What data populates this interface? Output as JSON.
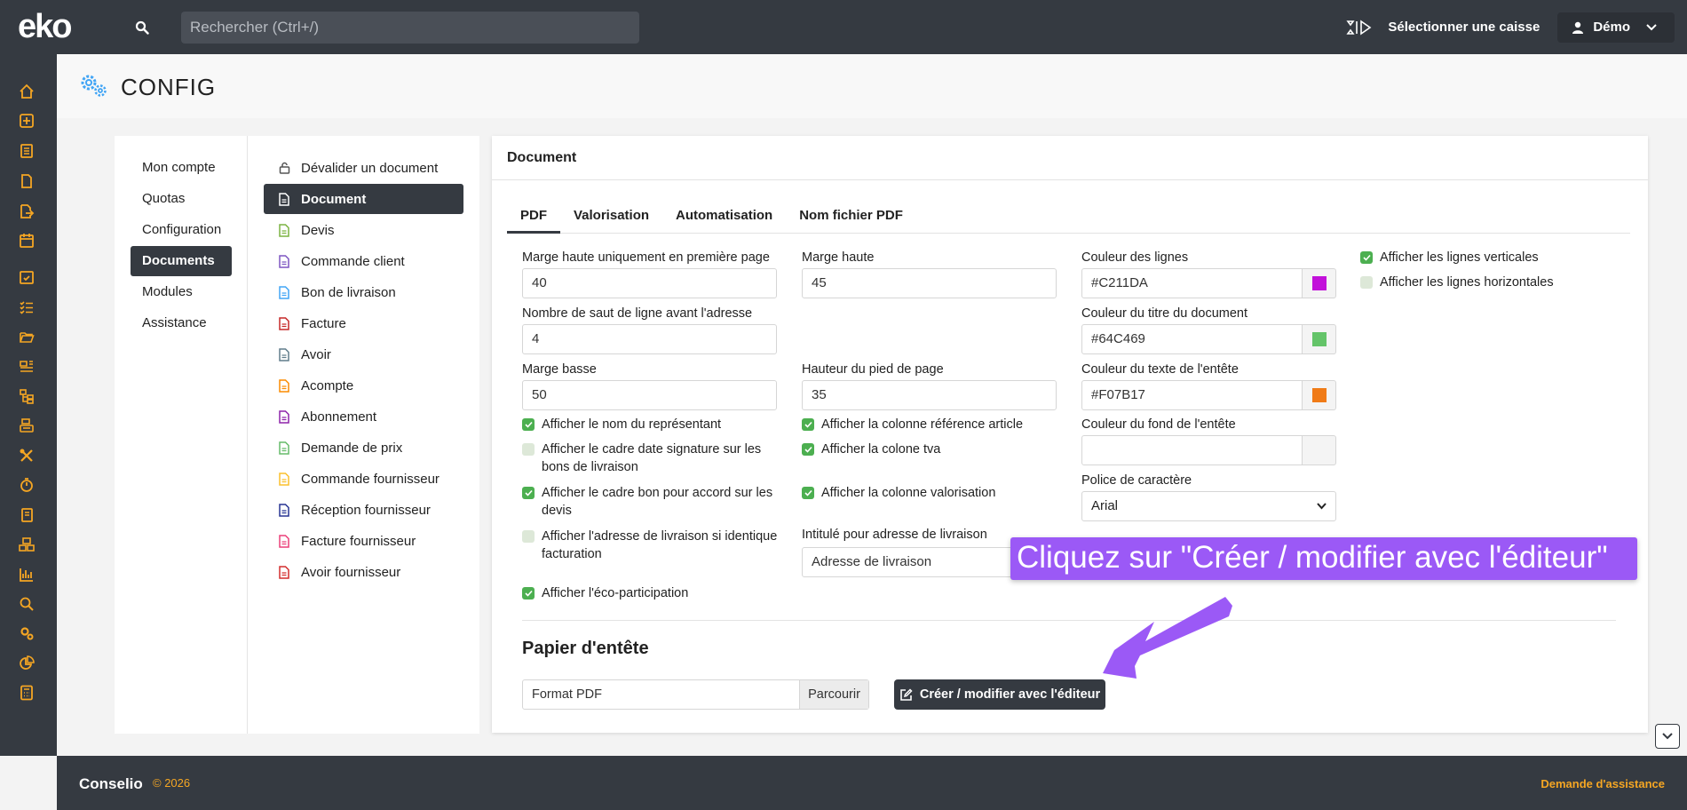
{
  "app": {
    "logo_text": "eko"
  },
  "topbar": {
    "search_placeholder": "Rechercher (Ctrl+/)",
    "caisse_label": "Sélectionner une caisse",
    "user_name": "Démo"
  },
  "page": {
    "title": "CONFIG"
  },
  "menu_main": [
    {
      "label": "Mon compte"
    },
    {
      "label": "Quotas"
    },
    {
      "label": "Configuration"
    },
    {
      "label": "Documents",
      "active": true
    },
    {
      "label": "Modules"
    },
    {
      "label": "Assistance"
    }
  ],
  "menu_docs": [
    {
      "label": "Dévalider un document",
      "color": "#555555"
    },
    {
      "label": "Document",
      "color": "#ffffff",
      "active": true
    },
    {
      "label": "Devis",
      "color": "#7cb342"
    },
    {
      "label": "Commande client",
      "color": "#7e57c2"
    },
    {
      "label": "Bon de livraison",
      "color": "#42a5f5"
    },
    {
      "label": "Facture",
      "color": "#c62828"
    },
    {
      "label": "Avoir",
      "color": "#607d8b"
    },
    {
      "label": "Acompte",
      "color": "#fb8c00"
    },
    {
      "label": "Abonnement",
      "color": "#8e24aa"
    },
    {
      "label": "Demande de prix",
      "color": "#66bb6a"
    },
    {
      "label": "Commande fournisseur",
      "color": "#fbc02d"
    },
    {
      "label": "Réception fournisseur",
      "color": "#283593"
    },
    {
      "label": "Facture fournisseur",
      "color": "#ec407a"
    },
    {
      "label": "Avoir fournisseur",
      "color": "#d32f2f"
    }
  ],
  "card": {
    "title": "Document",
    "tabs": [
      "PDF",
      "Valorisation",
      "Automatisation",
      "Nom fichier PDF"
    ],
    "fields": {
      "marge_haute_premiere": {
        "label": "Marge haute uniquement en première page",
        "value": "40"
      },
      "marge_haute": {
        "label": "Marge haute",
        "value": "45"
      },
      "saut_ligne": {
        "label": "Nombre de saut de ligne avant l'adresse",
        "value": "4"
      },
      "marge_basse": {
        "label": "Marge basse",
        "value": "50"
      },
      "hauteur_pied": {
        "label": "Hauteur du pied de page",
        "value": "35"
      },
      "couleur_lignes": {
        "label": "Couleur des lignes",
        "value": "#C211DA",
        "swatch": "#C211DA"
      },
      "couleur_titre": {
        "label": "Couleur du titre du document",
        "value": "#64C469",
        "swatch": "#64C469"
      },
      "couleur_texte_entete": {
        "label": "Couleur du texte de l'entête",
        "value": "#F07B17",
        "swatch": "#F07B17"
      },
      "couleur_fond_entete": {
        "label": "Couleur du fond de l'entête",
        "value": ""
      },
      "police": {
        "label": "Police de caractère",
        "value": "Arial"
      },
      "intitule_adresse": {
        "label": "Intitulé pour adresse de livraison",
        "value": "Adresse de livraison"
      }
    },
    "checkboxes": {
      "nom_representant": {
        "label": "Afficher le nom du représentant",
        "checked": true
      },
      "cadre_date_signature": {
        "label": "Afficher le cadre date signature sur les bons de livraison",
        "checked": false
      },
      "cadre_bon_accord": {
        "label": "Afficher le cadre bon pour accord sur les devis",
        "checked": true
      },
      "adresse_livraison_identique": {
        "label": "Afficher l'adresse de livraison si identique facturation",
        "checked": false
      },
      "eco_participation": {
        "label": "Afficher l'éco-participation",
        "checked": true
      },
      "colonne_reference": {
        "label": "Afficher la colonne référence article",
        "checked": true
      },
      "colonne_tva": {
        "label": "Afficher la colone tva",
        "checked": true
      },
      "colonne_valorisation": {
        "label": "Afficher la colonne valorisation",
        "checked": true
      },
      "lignes_verticales": {
        "label": "Afficher les lignes verticales",
        "checked": true
      },
      "lignes_horizontales": {
        "label": "Afficher les lignes horizontales",
        "checked": false
      }
    },
    "papier": {
      "title": "Papier d'entête",
      "file_placeholder": "Format PDF",
      "browse_label": "Parcourir",
      "editor_button": "Créer / modifier avec l'éditeur"
    }
  },
  "annotation": {
    "text": "Cliquez sur \"Créer / modifier avec l'éditeur\"",
    "color": "#9b59f6"
  },
  "footer": {
    "brand": "Conselio",
    "year": "© 2026",
    "help": "Demande d'assistance"
  },
  "colors": {
    "dark": "#353a41",
    "accent": "#f5a623"
  }
}
